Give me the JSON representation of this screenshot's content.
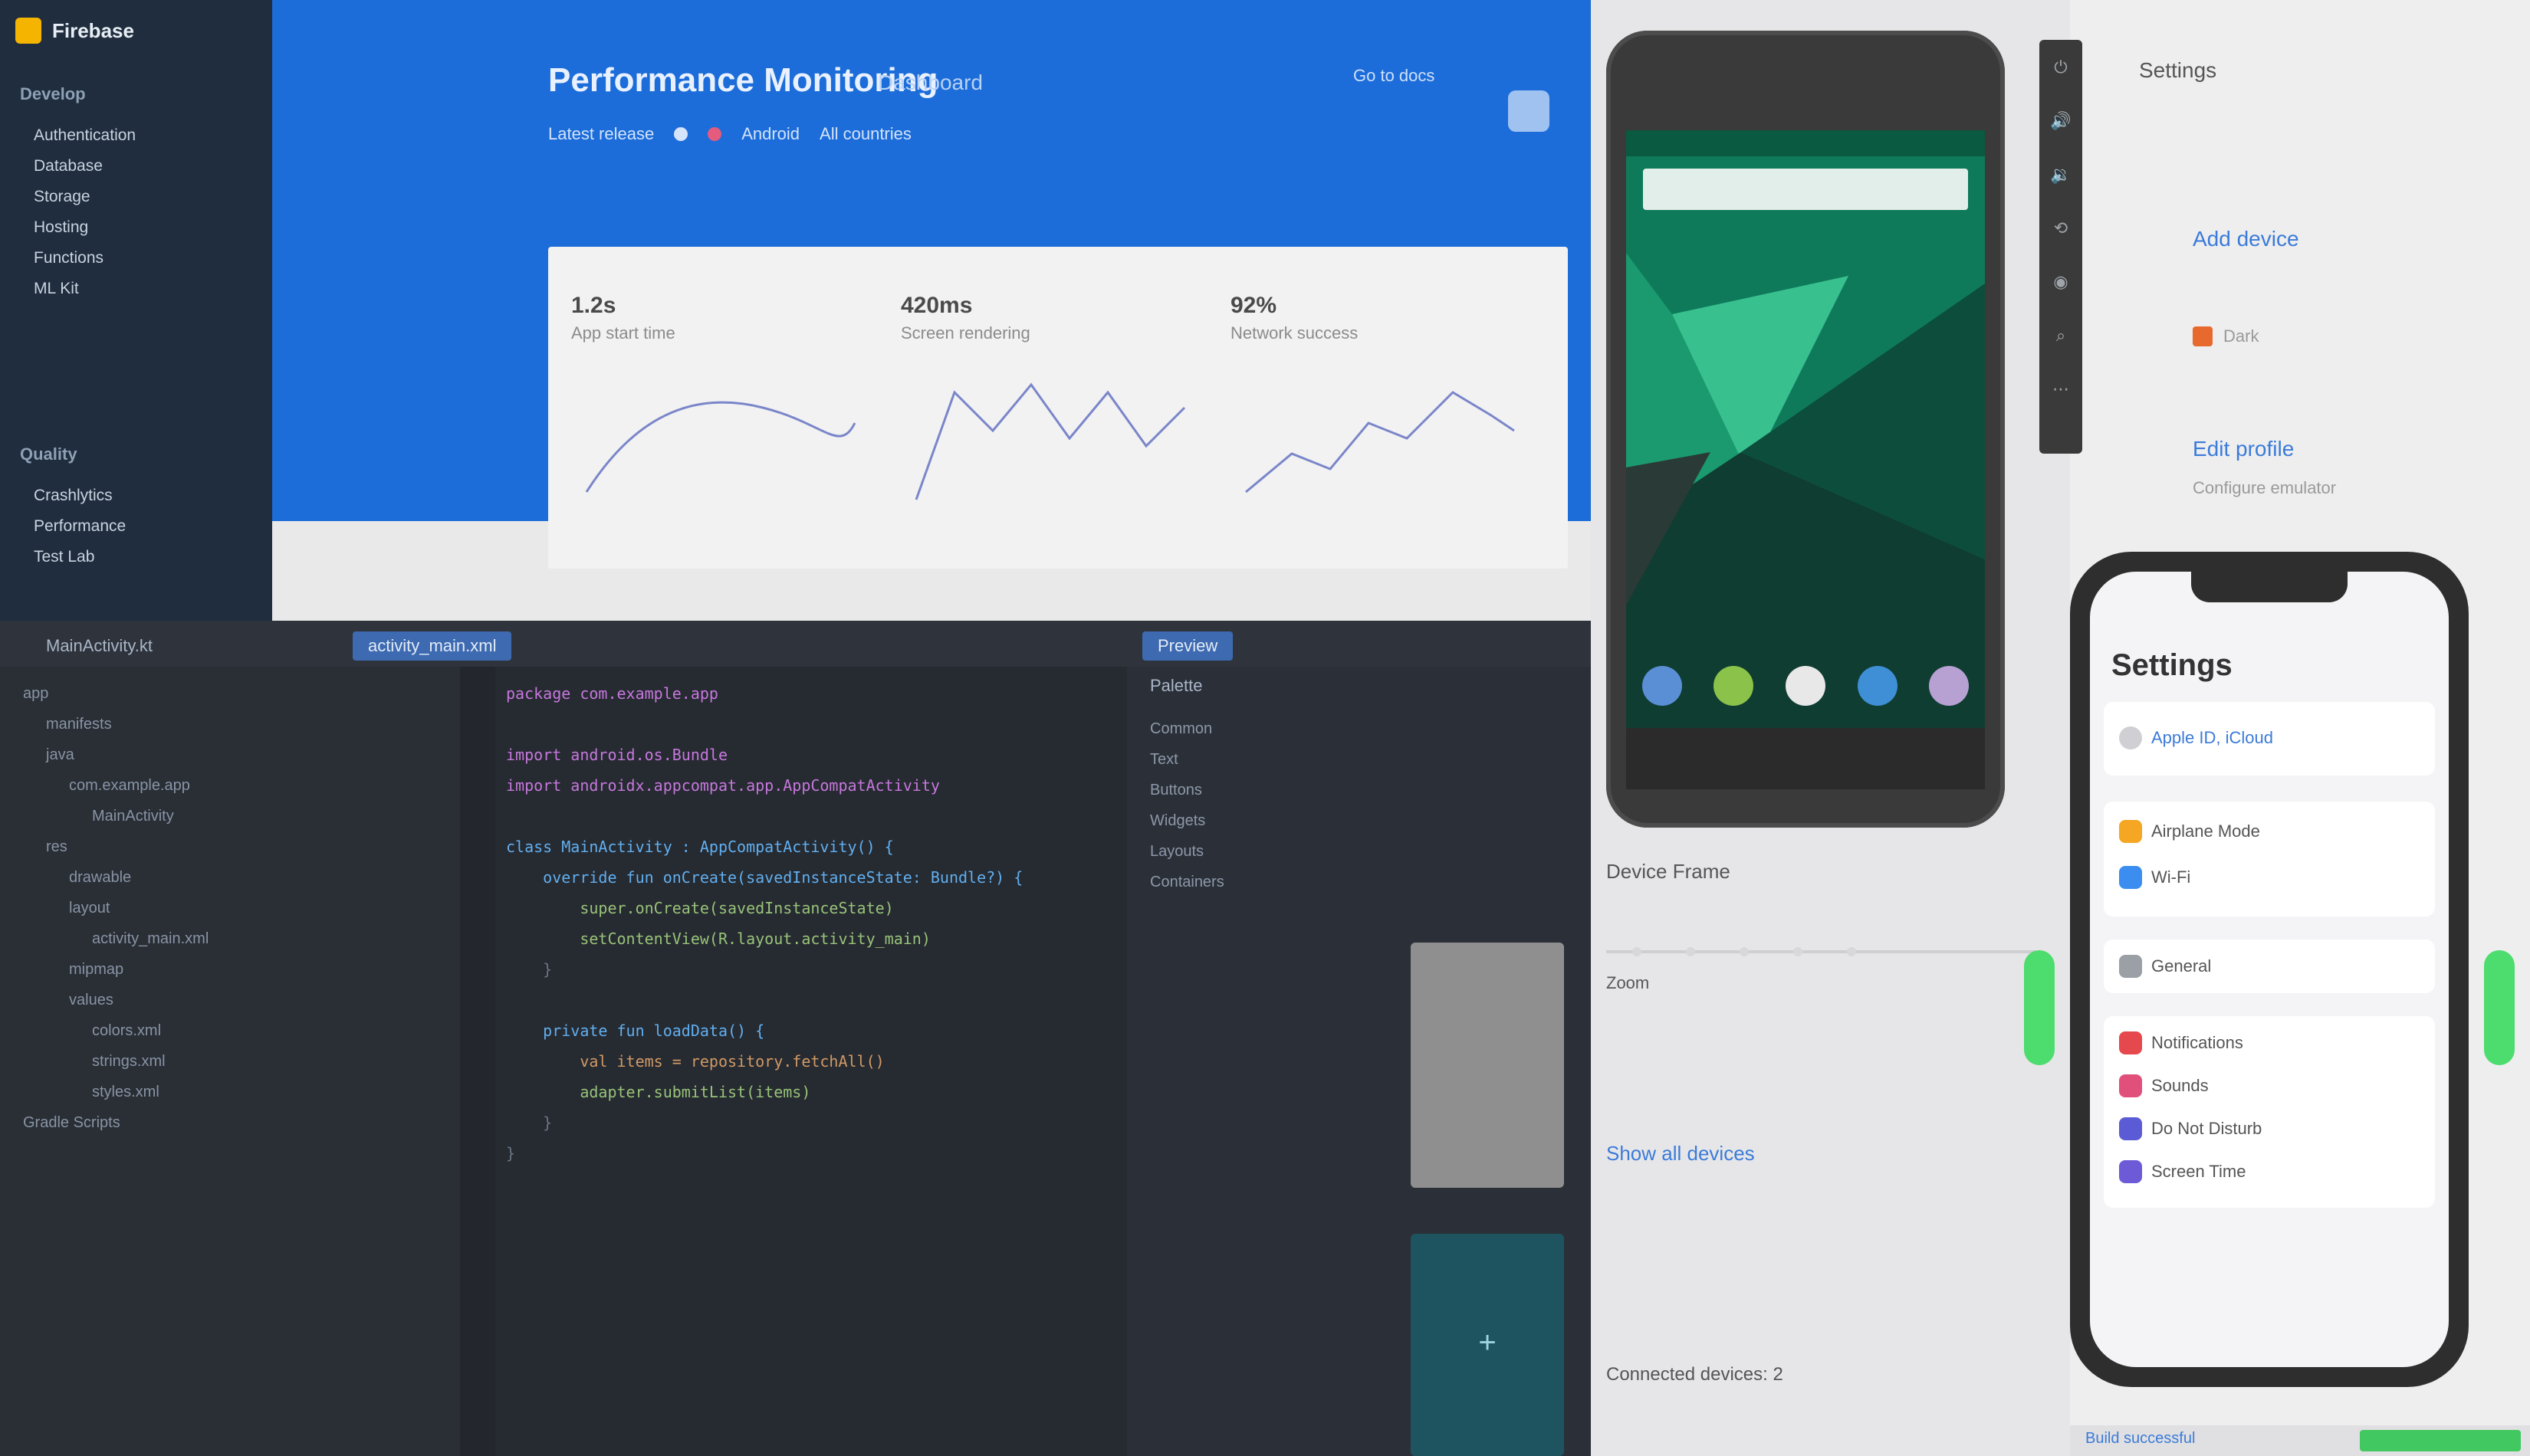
{
  "left_nav": {
    "brand": "Firebase",
    "sections": [
      {
        "label": "Develop",
        "items": [
          "Authentication",
          "Database",
          "Storage",
          "Hosting",
          "Functions",
          "ML Kit"
        ]
      },
      {
        "label": "Quality",
        "items": [
          "Crashlytics",
          "Performance",
          "Test Lab"
        ]
      }
    ]
  },
  "webapp": {
    "title": "Performance Monitoring",
    "subtitle": "Dashboard",
    "meta": [
      "Latest release",
      "Android",
      "All countries"
    ],
    "top_right": "Go to docs",
    "metrics": [
      {
        "value": "1.2s",
        "label": "App start time"
      },
      {
        "value": "420ms",
        "label": "Screen rendering"
      },
      {
        "value": "92%",
        "label": "Network success"
      }
    ]
  },
  "editor": {
    "tabs": [
      "MainActivity.kt",
      "activity_main.xml",
      "Preview"
    ],
    "tree": [
      "app",
      "manifests",
      "java",
      "com.example.app",
      "MainActivity",
      "res",
      "drawable",
      "layout",
      "activity_main.xml",
      "mipmap",
      "values",
      "colors.xml",
      "strings.xml",
      "styles.xml",
      "Gradle Scripts"
    ],
    "code": [
      {
        "t": "package com.example.app",
        "c": "kw"
      },
      {
        "t": "",
        "c": ""
      },
      {
        "t": "import android.os.Bundle",
        "c": "kw"
      },
      {
        "t": "import androidx.appcompat.app.AppCompatActivity",
        "c": "kw"
      },
      {
        "t": "",
        "c": ""
      },
      {
        "t": "class MainActivity : AppCompatActivity() {",
        "c": "fn"
      },
      {
        "t": "    override fun onCreate(savedInstanceState: Bundle?) {",
        "c": "fn"
      },
      {
        "t": "        super.onCreate(savedInstanceState)",
        "c": "str"
      },
      {
        "t": "        setContentView(R.layout.activity_main)",
        "c": "str"
      },
      {
        "t": "    }",
        "c": "cmt"
      },
      {
        "t": "",
        "c": ""
      },
      {
        "t": "    private fun loadData() {",
        "c": "fn"
      },
      {
        "t": "        val items = repository.fetchAll()",
        "c": "num"
      },
      {
        "t": "        adapter.submitList(items)",
        "c": "str"
      },
      {
        "t": "    }",
        "c": "cmt"
      },
      {
        "t": "}",
        "c": "cmt"
      }
    ],
    "panel_title": "Palette",
    "panel_list": [
      "Common",
      "Text",
      "Buttons",
      "Widgets",
      "Layouts",
      "Containers"
    ],
    "add_symbol": "+"
  },
  "right_panel": {
    "title": "Settings",
    "links": [
      "Add device",
      "Edit profile"
    ],
    "sub": "Configure emulator",
    "swatch_label": "Dark"
  },
  "mid_controls": {
    "label": "Device Frame",
    "link": "Show all devices",
    "zoom_label": "Zoom",
    "footer_label": "Connected devices: 2"
  },
  "iphone": {
    "heading": "Settings",
    "account_row": "Apple ID, iCloud",
    "rows1": [
      "Airplane Mode",
      "Wi-Fi"
    ],
    "rows2": [
      "Notifications",
      "Sounds",
      "Do Not Disturb",
      "Screen Time"
    ],
    "misc_row": "General"
  },
  "bottom_status": {
    "text": "Build successful"
  },
  "colors": {
    "accent": "#1c6dd9",
    "android_green": "#0f7a5a",
    "editor_bg": "#25292f"
  }
}
